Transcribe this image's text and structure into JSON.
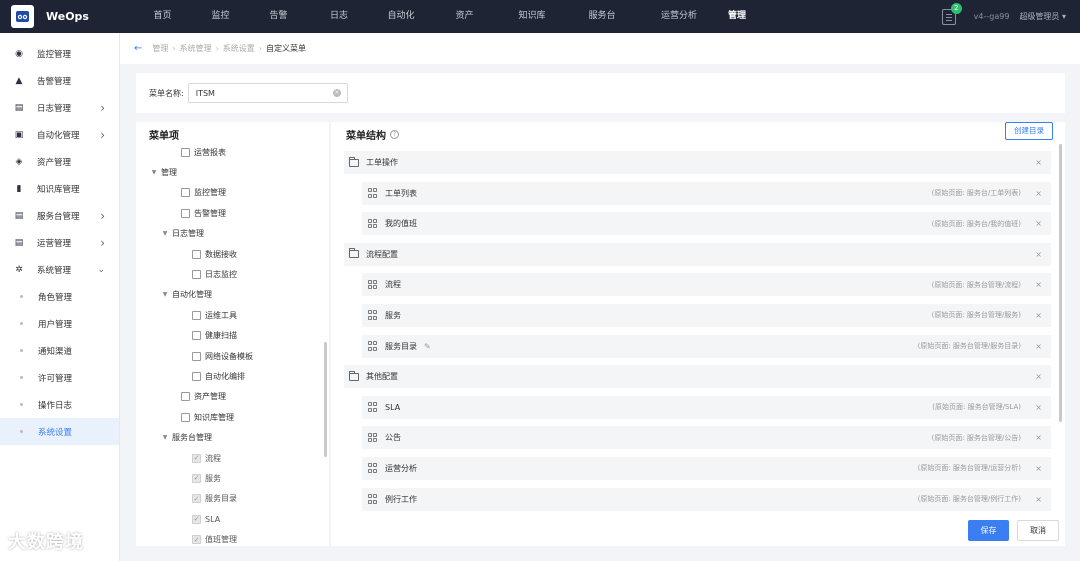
{
  "app": {
    "brand": "WeOps"
  },
  "topnav": [
    {
      "label": "首页",
      "name": "nav-home",
      "w": 61
    },
    {
      "label": "监控",
      "name": "nav-monitor",
      "w": 55
    },
    {
      "label": "告警",
      "name": "nav-alert",
      "w": 61
    },
    {
      "label": "日志",
      "name": "nav-log",
      "w": 60
    },
    {
      "label": "自动化",
      "name": "nav-automation",
      "w": 64
    },
    {
      "label": "资产",
      "name": "nav-assets",
      "w": 63
    },
    {
      "label": "知识库",
      "name": "nav-knowledge",
      "w": 72
    },
    {
      "label": "服务台",
      "name": "nav-servicedesk",
      "w": 68
    },
    {
      "label": "运营分析",
      "name": "nav-analysis",
      "w": 86
    },
    {
      "label": "管理",
      "name": "nav-admin",
      "w": 30,
      "active": true
    }
  ],
  "topright": {
    "notifications": "2",
    "version": "v4--ga99",
    "user": "超级管理员 ▾"
  },
  "sidebar": {
    "items": [
      {
        "label": "监控管理",
        "icon": "monitor-icon",
        "glyph": "◉",
        "chev": false
      },
      {
        "label": "告警管理",
        "icon": "alert-icon",
        "glyph": "▲",
        "chev": false
      },
      {
        "label": "日志管理",
        "icon": "log-icon",
        "glyph": "▤",
        "chev": true
      },
      {
        "label": "自动化管理",
        "icon": "automation-icon",
        "glyph": "▣",
        "chev": true
      },
      {
        "label": "资产管理",
        "icon": "assets-icon",
        "glyph": "◈",
        "chev": false
      },
      {
        "label": "知识库管理",
        "icon": "book-icon",
        "glyph": "▮",
        "chev": false
      },
      {
        "label": "服务台管理",
        "icon": "servicedesk-icon",
        "glyph": "▤",
        "chev": true
      },
      {
        "label": "运营管理",
        "icon": "operation-icon",
        "glyph": "▤",
        "chev": true
      },
      {
        "label": "系统管理",
        "icon": "settings-icon",
        "glyph": "✲",
        "chev": true,
        "open": true
      }
    ],
    "subitems": [
      "角色管理",
      "用户管理",
      "通知渠道",
      "许可管理",
      "操作日志",
      "系统设置"
    ],
    "active_sub": "系统设置"
  },
  "breadcrumb": [
    "管理",
    "系统管理",
    "系统设置",
    "自定义菜单"
  ],
  "menu_name": {
    "label": "菜单名称:",
    "value": "ITSM"
  },
  "left_panel": {
    "title": "菜单项",
    "nodes": [
      {
        "label": "运营报表",
        "level": 1,
        "type": "check"
      },
      {
        "label": "管理",
        "level": 0,
        "type": "group"
      },
      {
        "label": "监控管理",
        "level": 1,
        "type": "check"
      },
      {
        "label": "告警管理",
        "level": 1,
        "type": "check"
      },
      {
        "label": "日志管理",
        "level": 1,
        "type": "group"
      },
      {
        "label": "数据接收",
        "level": 2,
        "type": "check"
      },
      {
        "label": "日志监控",
        "level": 2,
        "type": "check"
      },
      {
        "label": "自动化管理",
        "level": 1,
        "type": "group"
      },
      {
        "label": "运维工具",
        "level": 2,
        "type": "check"
      },
      {
        "label": "健康扫描",
        "level": 2,
        "type": "check"
      },
      {
        "label": "网络设备模板",
        "level": 2,
        "type": "check"
      },
      {
        "label": "自动化编排",
        "level": 2,
        "type": "check"
      },
      {
        "label": "资产管理",
        "level": 1,
        "type": "check"
      },
      {
        "label": "知识库管理",
        "level": 1,
        "type": "check"
      },
      {
        "label": "服务台管理",
        "level": 1,
        "type": "group"
      },
      {
        "label": "流程",
        "level": 2,
        "type": "checked-disabled"
      },
      {
        "label": "服务",
        "level": 2,
        "type": "checked-disabled"
      },
      {
        "label": "服务目录",
        "level": 2,
        "type": "checked-disabled"
      },
      {
        "label": "SLA",
        "level": 2,
        "type": "checked-disabled"
      },
      {
        "label": "值班管理",
        "level": 2,
        "type": "checked-disabled"
      }
    ]
  },
  "right_panel": {
    "title": "菜单结构",
    "create_label": "创建目录",
    "rows": [
      {
        "kind": "dir",
        "label": "工单操作",
        "orig": ""
      },
      {
        "kind": "child",
        "label": "工单列表",
        "orig": "(原始页面: 服务台/工单列表)"
      },
      {
        "kind": "child",
        "label": "我的值班",
        "orig": "(原始页面: 服务台/我的值班)"
      },
      {
        "kind": "dir",
        "label": "流程配置",
        "orig": ""
      },
      {
        "kind": "child",
        "label": "流程",
        "orig": "(原始页面: 服务台管理/流程)"
      },
      {
        "kind": "child",
        "label": "服务",
        "orig": "(原始页面: 服务台管理/服务)"
      },
      {
        "kind": "child",
        "label": "服务目录",
        "orig": "(原始页面: 服务台管理/服务目录)",
        "editable": true
      },
      {
        "kind": "dir",
        "label": "其他配置",
        "orig": ""
      },
      {
        "kind": "child",
        "label": "SLA",
        "orig": "(原始页面: 服务台管理/SLA)"
      },
      {
        "kind": "child",
        "label": "公告",
        "orig": "(原始页面: 服务台管理/公告)"
      },
      {
        "kind": "child",
        "label": "运营分析",
        "orig": "(原始页面: 服务台管理/运营分析)"
      },
      {
        "kind": "child",
        "label": "例行工作",
        "orig": "(原始页面: 服务台管理/例行工作)"
      }
    ],
    "save_label": "保存",
    "cancel_label": "取消"
  },
  "watermark": "大数跨境"
}
